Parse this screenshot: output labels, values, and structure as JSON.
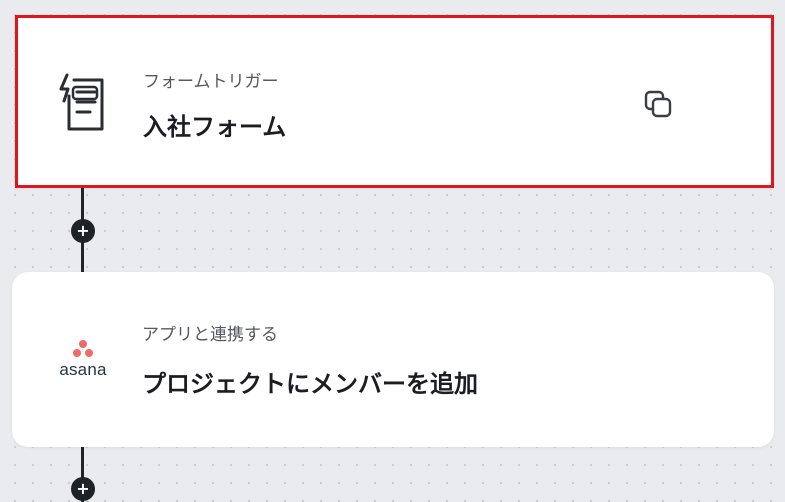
{
  "workflow": {
    "steps": [
      {
        "subtitle": "フォームトリガー",
        "title": "入社フォーム",
        "icon": "form-trigger-icon",
        "selected": true,
        "selection_color": "#e0161e"
      },
      {
        "subtitle": "アプリと連携する",
        "title": "プロジェクトにメンバーを追加",
        "icon": "asana-logo",
        "logo_text": "asana",
        "logo_color": "#f06a6a"
      }
    ],
    "add_step_symbol": "+"
  },
  "icons": {
    "copy": "copy-icon"
  }
}
